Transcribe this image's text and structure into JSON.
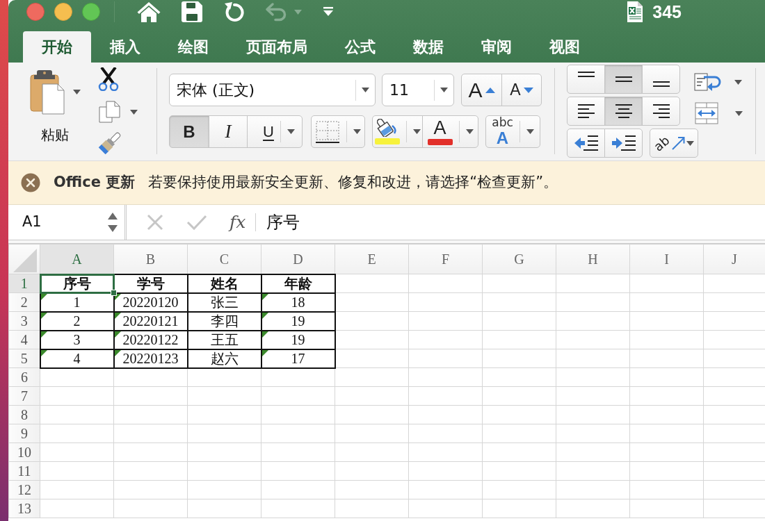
{
  "window": {
    "title": "345"
  },
  "quick_access": [
    {
      "kind": "home",
      "disabled": false
    },
    {
      "kind": "save",
      "disabled": false
    },
    {
      "kind": "redo",
      "disabled": false
    },
    {
      "kind": "undo",
      "disabled": true
    },
    {
      "kind": "customize",
      "disabled": false
    }
  ],
  "tabs": [
    {
      "label": "开始",
      "selected": true
    },
    {
      "label": "插入",
      "selected": false
    },
    {
      "label": "绘图",
      "selected": false
    },
    {
      "label": "页面布局",
      "selected": false
    },
    {
      "label": "公式",
      "selected": false
    },
    {
      "label": "数据",
      "selected": false
    },
    {
      "label": "审阅",
      "selected": false
    },
    {
      "label": "视图",
      "selected": false
    }
  ],
  "ribbon": {
    "clipboard": {
      "paste_label": "粘贴"
    },
    "font": {
      "name": "宋体 (正文)",
      "size": "11",
      "grow_label": "A",
      "shrink_label": "A",
      "styles": [
        {
          "kind": "bold",
          "label": "B",
          "on": true
        },
        {
          "kind": "italic",
          "label": "I",
          "on": false
        },
        {
          "kind": "underline",
          "label": "U",
          "on": false
        }
      ],
      "color_buttons": [
        {
          "kind": "fill",
          "color": "#f7f23c"
        },
        {
          "kind": "font",
          "label": "A",
          "color": "#e2302a"
        }
      ],
      "text_effects": {
        "label_top": "abc",
        "label_bottom": "A"
      }
    },
    "alignment": {
      "vertical": [
        {
          "kind": "top",
          "selected": false
        },
        {
          "kind": "middle",
          "selected": true
        },
        {
          "kind": "bottom",
          "selected": false
        }
      ],
      "horizontal": [
        {
          "kind": "left",
          "selected": false
        },
        {
          "kind": "center",
          "selected": true
        },
        {
          "kind": "right",
          "selected": false
        }
      ],
      "orientation_label": "ab"
    }
  },
  "notification": {
    "title": "Office 更新",
    "message": "若要保持使用最新安全更新、修复和改进，请选择“检查更新”。"
  },
  "formula_bar": {
    "name_box": "A1",
    "function_label": "fx",
    "content": "序号"
  },
  "sheet": {
    "columns": [
      {
        "label": "A",
        "selected": true
      },
      {
        "label": "B",
        "selected": false
      },
      {
        "label": "C",
        "selected": false
      },
      {
        "label": "D",
        "selected": false
      },
      {
        "label": "E",
        "selected": false
      },
      {
        "label": "F",
        "selected": false
      },
      {
        "label": "G",
        "selected": false
      },
      {
        "label": "H",
        "selected": false
      },
      {
        "label": "I",
        "selected": false
      },
      {
        "label": "J",
        "selected": false
      }
    ],
    "rows": [
      {
        "label": "1",
        "selected": true,
        "bold": true,
        "cells": [
          {
            "text": "序号",
            "flagged": false
          },
          {
            "text": "学号",
            "flagged": false
          },
          {
            "text": "姓名",
            "flagged": false
          },
          {
            "text": "年龄",
            "flagged": false
          }
        ]
      },
      {
        "label": "2",
        "selected": false,
        "bold": false,
        "cells": [
          {
            "text": "1",
            "flagged": true
          },
          {
            "text": "20220120",
            "flagged": true
          },
          {
            "text": "张三",
            "flagged": false
          },
          {
            "text": "18",
            "flagged": true
          }
        ]
      },
      {
        "label": "3",
        "selected": false,
        "bold": false,
        "cells": [
          {
            "text": "2",
            "flagged": true
          },
          {
            "text": "20220121",
            "flagged": true
          },
          {
            "text": "李四",
            "flagged": false
          },
          {
            "text": "19",
            "flagged": true
          }
        ]
      },
      {
        "label": "4",
        "selected": false,
        "bold": false,
        "cells": [
          {
            "text": "3",
            "flagged": true
          },
          {
            "text": "20220122",
            "flagged": true
          },
          {
            "text": "王五",
            "flagged": false
          },
          {
            "text": "19",
            "flagged": true
          }
        ]
      },
      {
        "label": "5",
        "selected": false,
        "bold": false,
        "cells": [
          {
            "text": "4",
            "flagged": true
          },
          {
            "text": "20220123",
            "flagged": true
          },
          {
            "text": "赵六",
            "flagged": false
          },
          {
            "text": "17",
            "flagged": true
          }
        ]
      },
      {
        "label": "6",
        "selected": false
      },
      {
        "label": "7",
        "selected": false
      },
      {
        "label": "8",
        "selected": false
      },
      {
        "label": "9",
        "selected": false
      },
      {
        "label": "10",
        "selected": false
      },
      {
        "label": "11",
        "selected": false
      },
      {
        "label": "12",
        "selected": false
      },
      {
        "label": "13",
        "selected": false
      }
    ]
  }
}
